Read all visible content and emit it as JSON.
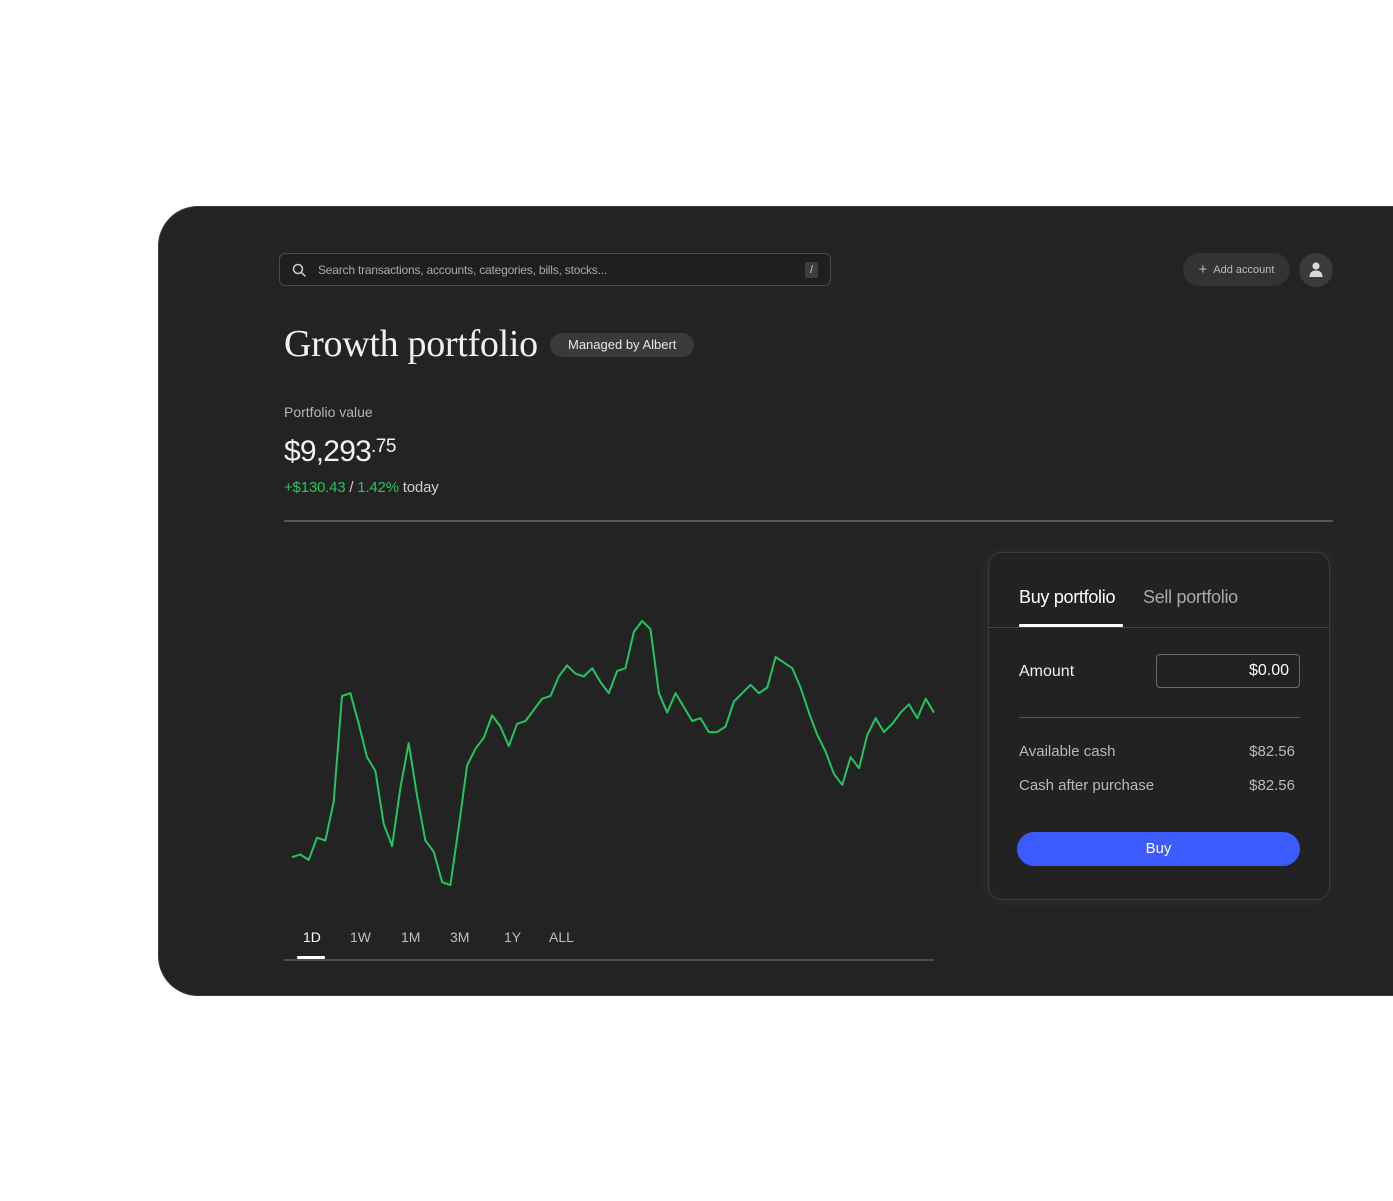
{
  "header": {
    "search_placeholder": "Search transactions, accounts, categories, bills, stocks...",
    "search_shortcut": "/",
    "add_account_label": "Add account"
  },
  "portfolio": {
    "title": "Growth portfolio",
    "badge": "Managed by Albert",
    "value_label": "Portfolio value",
    "value_main": "$9,293",
    "value_cents": ".75",
    "change_amount": "+$130.43",
    "change_separator": " / ",
    "change_percent": "1.42%",
    "change_suffix": " today"
  },
  "time_ranges": [
    "1D",
    "1W",
    "1M",
    "3M",
    "1Y",
    "ALL"
  ],
  "selected_range": "1D",
  "trade_panel": {
    "tabs": [
      "Buy portfolio",
      "Sell portfolio"
    ],
    "active_tab": "Buy portfolio",
    "amount_label": "Amount",
    "amount_value": "$0.00",
    "available_cash_label": "Available cash",
    "available_cash_value": "$82.56",
    "cash_after_label": "Cash after purchase",
    "cash_after_value": "$82.56",
    "buy_label": "Buy"
  },
  "colors": {
    "background": "#232323",
    "positive": "#22c55e",
    "accent": "#3b5bfd",
    "text": "#f0f0f0"
  },
  "chart_data": {
    "type": "line",
    "title": "",
    "xlabel": "",
    "ylabel": "",
    "grid": false,
    "ylim": [
      0,
      100
    ],
    "series": [
      {
        "values": [
          10,
          11,
          9,
          17,
          16,
          30,
          68,
          69,
          58,
          46,
          41,
          22,
          14,
          35,
          51,
          32,
          16,
          12,
          1,
          0,
          21,
          43,
          49,
          53,
          61,
          57,
          50,
          58,
          59,
          63,
          67,
          68,
          75,
          79,
          76,
          75,
          78,
          73,
          69,
          77,
          78,
          91,
          95,
          92,
          69,
          62,
          69,
          64,
          59,
          60,
          55,
          55,
          57,
          66,
          69,
          72,
          69,
          71,
          82,
          80,
          78,
          71,
          62,
          54,
          48,
          40,
          36,
          46,
          42,
          54,
          60,
          55,
          58,
          62,
          65,
          60,
          67,
          62
        ]
      }
    ]
  }
}
